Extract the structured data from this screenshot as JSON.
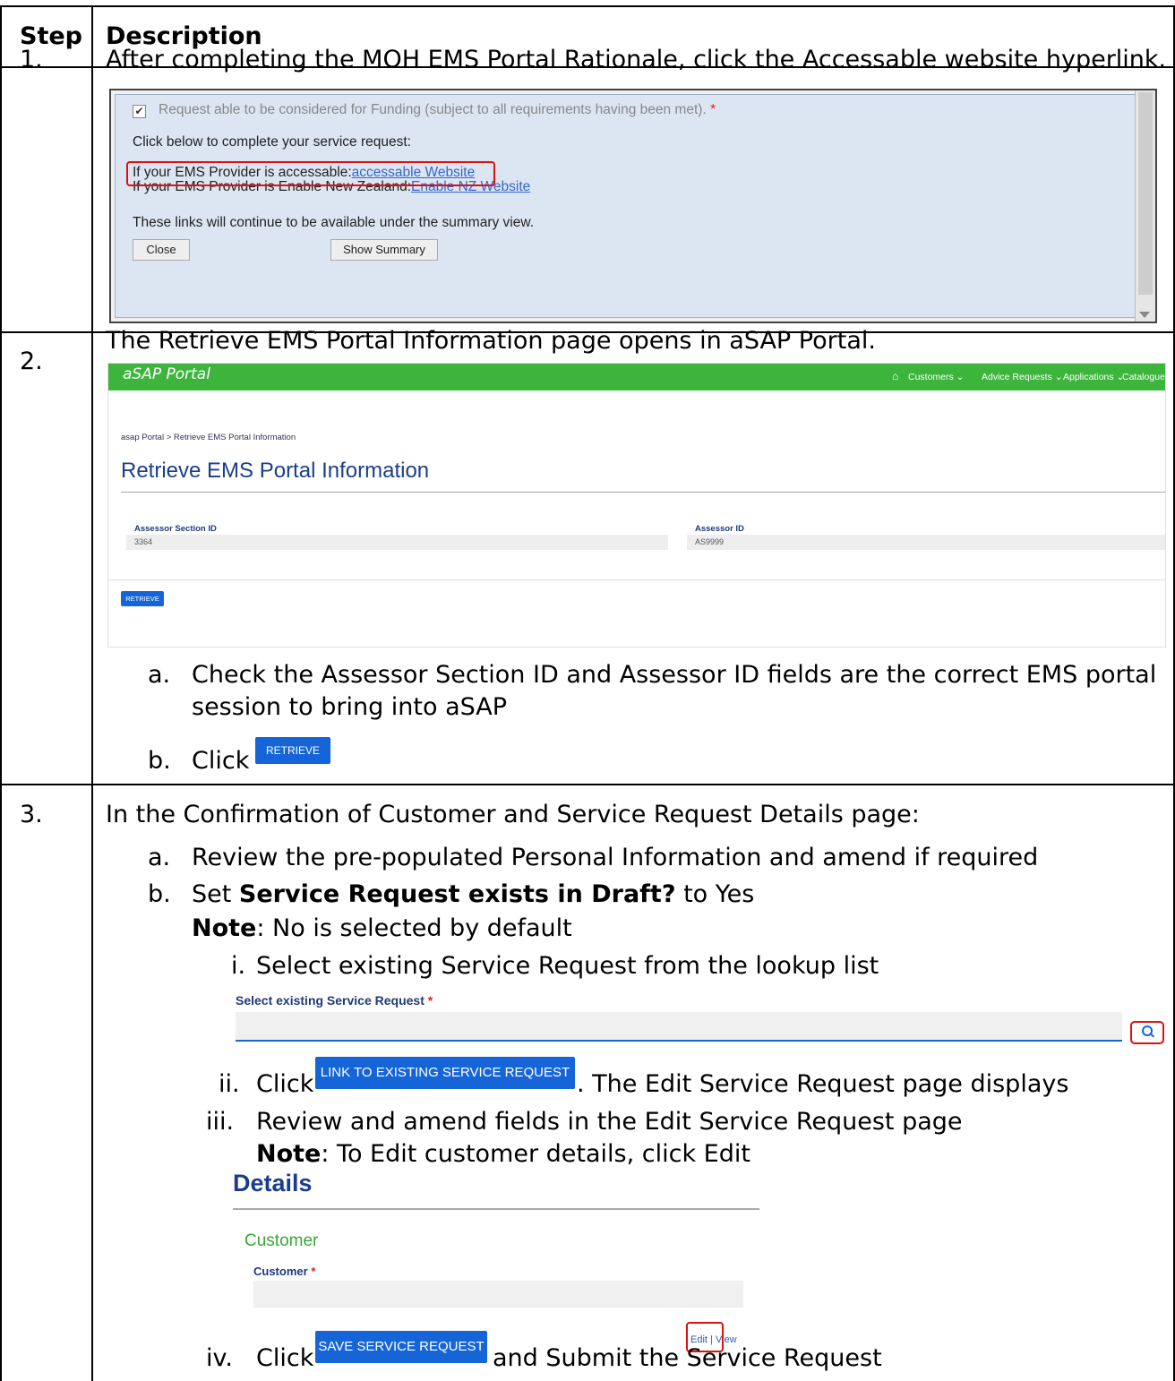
{
  "table": {
    "headers": [
      "Step",
      "Description"
    ],
    "step1": {
      "number": "1.",
      "text": "After completing the MOH EMS Portal Rationale, click the Accessable website hyperlink."
    },
    "step2": {
      "number": "2.",
      "text": "The Retrieve EMS Portal Information page opens in aSAP Portal.",
      "a": "Check the Assessor Section ID and Assessor ID fields are the correct EMS portal",
      "a_cont": "session to bring into aSAP",
      "b": "Click"
    },
    "step3": {
      "number": "3.",
      "intro": "In the Confirmation of Customer and Service Request Details page:",
      "a": "Review the pre-populated Personal Information and amend if required",
      "b_pre": "Set ",
      "b_bold": "Service Request exists in Draft?",
      "b_post": " to Yes",
      "note_label": "Note",
      "note1": ": No is selected by default",
      "i": "Select existing Service Request from the lookup list",
      "ii_pre": "Click",
      "ii_post": ". The Edit Service Request page displays",
      "iii": "Review and amend fields in the Edit Service Request page",
      "note2": ": To Edit customer details, click Edit",
      "iv_pre": "Click",
      "iv_post": "and Submit the Service Request"
    }
  },
  "markers": {
    "a": "a.",
    "b": "b.",
    "i": "i.",
    "ii": "ii.",
    "iii": "iii.",
    "iv": "iv."
  },
  "shot1": {
    "checkbox_text": "Request able to be considered for Funding (subject to all requirements having been met).",
    "required_mark": "*",
    "click_below": "Click below to complete your service request:",
    "line1_pre": "If your EMS Provider is accessable:",
    "line1_link": "accessable Website",
    "line2_pre": "If your EMS Provider is Enable New Zealand:",
    "line2_link": "Enable NZ Website",
    "links_note": "These links will continue to be available under the summary view.",
    "close_btn": "Close",
    "summary_btn": "Show Summary"
  },
  "shot2": {
    "brand": "aSAP Portal",
    "nav": [
      "Customers ⌄",
      "Advice Requests ⌄",
      "Applications ⌄",
      "Catalogue ⌄"
    ],
    "breadcrumb": "asap Portal  >  Retrieve EMS Portal Information",
    "title": "Retrieve EMS Portal Information",
    "label1": "Assessor Section ID",
    "value1": "3364",
    "label2": "Assessor ID",
    "value2": "AS9999",
    "retrieve_btn": "RETRIEVE"
  },
  "inline_buttons": {
    "retrieve": "RETRIEVE",
    "link_existing": "LINK TO EXISTING SERVICE REQUEST",
    "save": "SAVE SERVICE REQUEST"
  },
  "shot3": {
    "label": "Select existing Service Request",
    "required_mark": "*"
  },
  "shot4": {
    "title": "Details",
    "section": "Customer",
    "label": "Customer",
    "required_mark": "*",
    "edit": "Edit",
    "sep": " | ",
    "view": "View"
  }
}
